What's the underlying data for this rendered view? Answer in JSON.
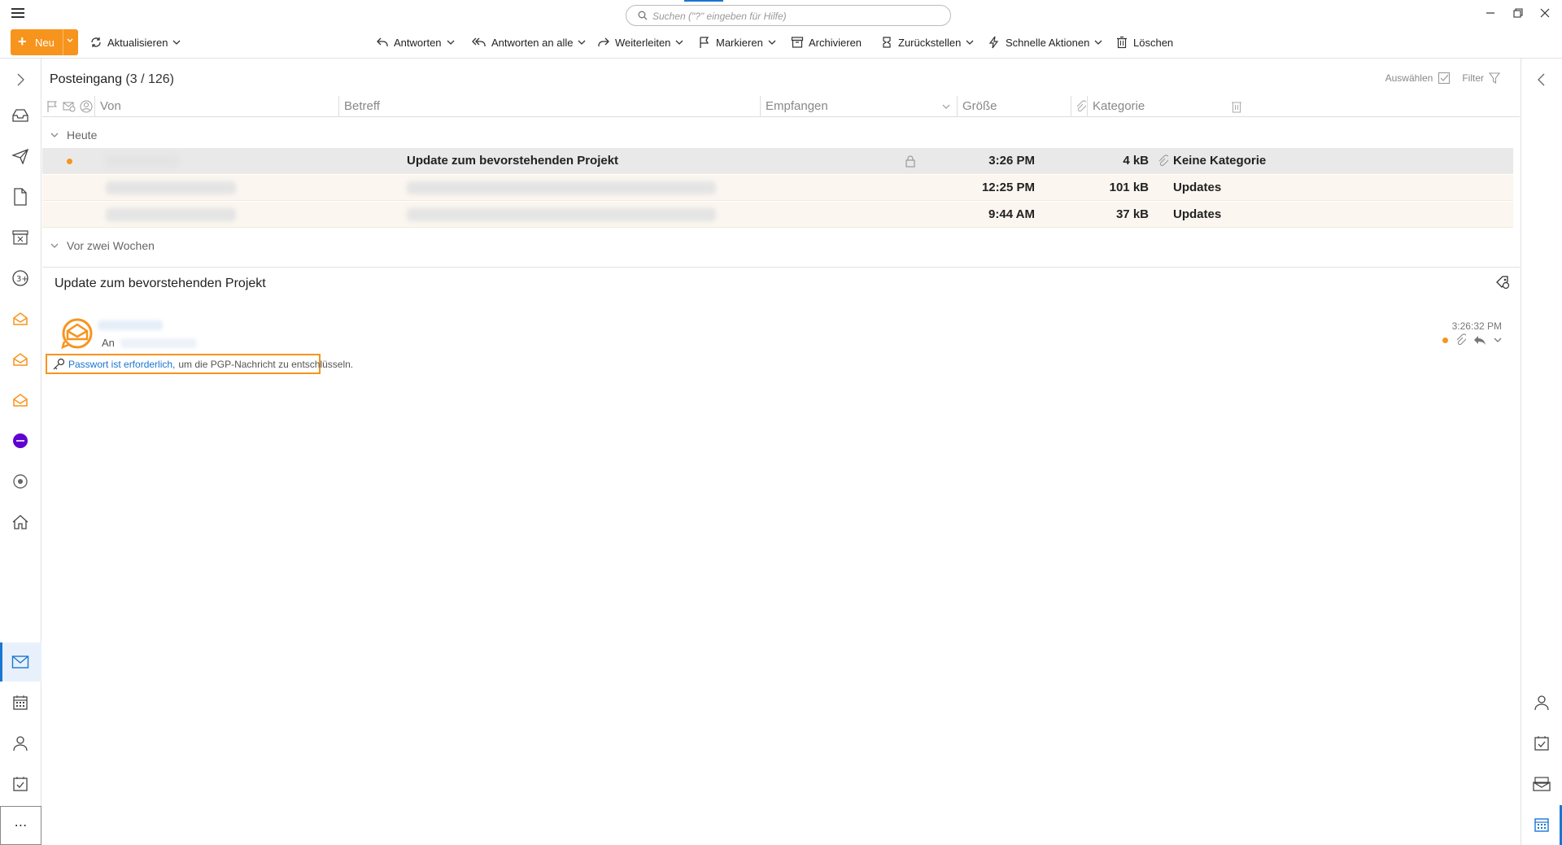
{
  "search": {
    "placeholder": "Suchen (\"?\" eingeben für Hilfe)"
  },
  "toolbar": {
    "new_label": "Neu",
    "refresh_label": "Aktualisieren",
    "reply_label": "Antworten",
    "reply_all_label": "Antworten an alle",
    "forward_label": "Weiterleiten",
    "flag_label": "Markieren",
    "archive_label": "Archivieren",
    "snooze_label": "Zurückstellen",
    "quick_actions_label": "Schnelle Aktionen",
    "delete_label": "Löschen"
  },
  "folder": {
    "name": "Posteingang",
    "count": "(3 / 126)"
  },
  "list_actions": {
    "select_label": "Auswählen",
    "filter_label": "Filter"
  },
  "columns": {
    "from": "Von",
    "subject": "Betreff",
    "received": "Empfangen",
    "size": "Größe",
    "category": "Kategorie"
  },
  "groups": {
    "today": "Heute",
    "two_weeks": "Vor zwei Wochen"
  },
  "messages": [
    {
      "subject": "Update zum bevorstehenden Projekt",
      "time": "3:26 PM",
      "size": "4 kB",
      "category": "Keine Kategorie"
    },
    {
      "subject": "",
      "time": "12:25 PM",
      "size": "101 kB",
      "category": "Updates"
    },
    {
      "subject": "",
      "time": "9:44 AM",
      "size": "37 kB",
      "category": "Updates"
    }
  ],
  "preview": {
    "subject": "Update zum bevorstehenden Projekt",
    "to_label": "An",
    "time": "3:26:32 PM",
    "pgp_link": "Passwort ist erforderlich,",
    "pgp_text": "um die PGP-Nachricht zu entschlüsseln."
  },
  "colors": {
    "accent": "#f7941d",
    "selection": "#1976d2"
  },
  "icons": {
    "left_sidebar": [
      "expand-icon",
      "inbox-icon",
      "sent-icon",
      "drafts-icon",
      "archive-icon",
      "contacts-group-icon",
      "account-envelope-icon",
      "account-envelope-icon",
      "account-envelope-icon",
      "yahoo-icon",
      "settings-icon",
      "home-icon",
      "mail-icon",
      "calendar-icon",
      "contacts-icon",
      "tasks-icon",
      "more-icon"
    ],
    "right_sidebar": [
      "collapse-icon",
      "contact-icon",
      "tasks-icon",
      "mail-stack-icon",
      "calendar-icon"
    ]
  }
}
